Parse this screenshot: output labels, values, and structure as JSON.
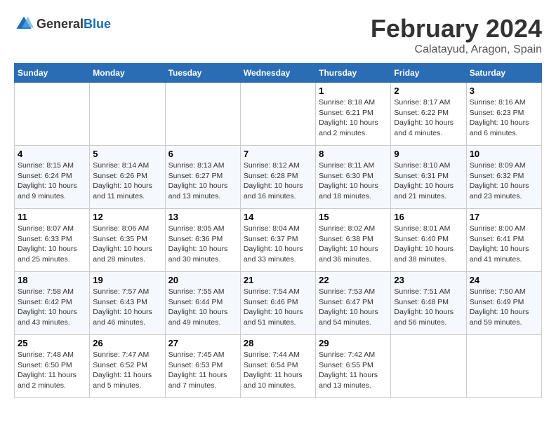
{
  "header": {
    "logo_general": "General",
    "logo_blue": "Blue",
    "month_year": "February 2024",
    "location": "Calatayud, Aragon, Spain"
  },
  "weekdays": [
    "Sunday",
    "Monday",
    "Tuesday",
    "Wednesday",
    "Thursday",
    "Friday",
    "Saturday"
  ],
  "weeks": [
    [
      {
        "day": "",
        "sunrise": "",
        "sunset": "",
        "daylight": ""
      },
      {
        "day": "",
        "sunrise": "",
        "sunset": "",
        "daylight": ""
      },
      {
        "day": "",
        "sunrise": "",
        "sunset": "",
        "daylight": ""
      },
      {
        "day": "",
        "sunrise": "",
        "sunset": "",
        "daylight": ""
      },
      {
        "day": "1",
        "sunrise": "Sunrise: 8:18 AM",
        "sunset": "Sunset: 6:21 PM",
        "daylight": "Daylight: 10 hours and 2 minutes."
      },
      {
        "day": "2",
        "sunrise": "Sunrise: 8:17 AM",
        "sunset": "Sunset: 6:22 PM",
        "daylight": "Daylight: 10 hours and 4 minutes."
      },
      {
        "day": "3",
        "sunrise": "Sunrise: 8:16 AM",
        "sunset": "Sunset: 6:23 PM",
        "daylight": "Daylight: 10 hours and 6 minutes."
      }
    ],
    [
      {
        "day": "4",
        "sunrise": "Sunrise: 8:15 AM",
        "sunset": "Sunset: 6:24 PM",
        "daylight": "Daylight: 10 hours and 9 minutes."
      },
      {
        "day": "5",
        "sunrise": "Sunrise: 8:14 AM",
        "sunset": "Sunset: 6:26 PM",
        "daylight": "Daylight: 10 hours and 11 minutes."
      },
      {
        "day": "6",
        "sunrise": "Sunrise: 8:13 AM",
        "sunset": "Sunset: 6:27 PM",
        "daylight": "Daylight: 10 hours and 13 minutes."
      },
      {
        "day": "7",
        "sunrise": "Sunrise: 8:12 AM",
        "sunset": "Sunset: 6:28 PM",
        "daylight": "Daylight: 10 hours and 16 minutes."
      },
      {
        "day": "8",
        "sunrise": "Sunrise: 8:11 AM",
        "sunset": "Sunset: 6:30 PM",
        "daylight": "Daylight: 10 hours and 18 minutes."
      },
      {
        "day": "9",
        "sunrise": "Sunrise: 8:10 AM",
        "sunset": "Sunset: 6:31 PM",
        "daylight": "Daylight: 10 hours and 21 minutes."
      },
      {
        "day": "10",
        "sunrise": "Sunrise: 8:09 AM",
        "sunset": "Sunset: 6:32 PM",
        "daylight": "Daylight: 10 hours and 23 minutes."
      }
    ],
    [
      {
        "day": "11",
        "sunrise": "Sunrise: 8:07 AM",
        "sunset": "Sunset: 6:33 PM",
        "daylight": "Daylight: 10 hours and 25 minutes."
      },
      {
        "day": "12",
        "sunrise": "Sunrise: 8:06 AM",
        "sunset": "Sunset: 6:35 PM",
        "daylight": "Daylight: 10 hours and 28 minutes."
      },
      {
        "day": "13",
        "sunrise": "Sunrise: 8:05 AM",
        "sunset": "Sunset: 6:36 PM",
        "daylight": "Daylight: 10 hours and 30 minutes."
      },
      {
        "day": "14",
        "sunrise": "Sunrise: 8:04 AM",
        "sunset": "Sunset: 6:37 PM",
        "daylight": "Daylight: 10 hours and 33 minutes."
      },
      {
        "day": "15",
        "sunrise": "Sunrise: 8:02 AM",
        "sunset": "Sunset: 6:38 PM",
        "daylight": "Daylight: 10 hours and 36 minutes."
      },
      {
        "day": "16",
        "sunrise": "Sunrise: 8:01 AM",
        "sunset": "Sunset: 6:40 PM",
        "daylight": "Daylight: 10 hours and 38 minutes."
      },
      {
        "day": "17",
        "sunrise": "Sunrise: 8:00 AM",
        "sunset": "Sunset: 6:41 PM",
        "daylight": "Daylight: 10 hours and 41 minutes."
      }
    ],
    [
      {
        "day": "18",
        "sunrise": "Sunrise: 7:58 AM",
        "sunset": "Sunset: 6:42 PM",
        "daylight": "Daylight: 10 hours and 43 minutes."
      },
      {
        "day": "19",
        "sunrise": "Sunrise: 7:57 AM",
        "sunset": "Sunset: 6:43 PM",
        "daylight": "Daylight: 10 hours and 46 minutes."
      },
      {
        "day": "20",
        "sunrise": "Sunrise: 7:55 AM",
        "sunset": "Sunset: 6:44 PM",
        "daylight": "Daylight: 10 hours and 49 minutes."
      },
      {
        "day": "21",
        "sunrise": "Sunrise: 7:54 AM",
        "sunset": "Sunset: 6:46 PM",
        "daylight": "Daylight: 10 hours and 51 minutes."
      },
      {
        "day": "22",
        "sunrise": "Sunrise: 7:53 AM",
        "sunset": "Sunset: 6:47 PM",
        "daylight": "Daylight: 10 hours and 54 minutes."
      },
      {
        "day": "23",
        "sunrise": "Sunrise: 7:51 AM",
        "sunset": "Sunset: 6:48 PM",
        "daylight": "Daylight: 10 hours and 56 minutes."
      },
      {
        "day": "24",
        "sunrise": "Sunrise: 7:50 AM",
        "sunset": "Sunset: 6:49 PM",
        "daylight": "Daylight: 10 hours and 59 minutes."
      }
    ],
    [
      {
        "day": "25",
        "sunrise": "Sunrise: 7:48 AM",
        "sunset": "Sunset: 6:50 PM",
        "daylight": "Daylight: 11 hours and 2 minutes."
      },
      {
        "day": "26",
        "sunrise": "Sunrise: 7:47 AM",
        "sunset": "Sunset: 6:52 PM",
        "daylight": "Daylight: 11 hours and 5 minutes."
      },
      {
        "day": "27",
        "sunrise": "Sunrise: 7:45 AM",
        "sunset": "Sunset: 6:53 PM",
        "daylight": "Daylight: 11 hours and 7 minutes."
      },
      {
        "day": "28",
        "sunrise": "Sunrise: 7:44 AM",
        "sunset": "Sunset: 6:54 PM",
        "daylight": "Daylight: 11 hours and 10 minutes."
      },
      {
        "day": "29",
        "sunrise": "Sunrise: 7:42 AM",
        "sunset": "Sunset: 6:55 PM",
        "daylight": "Daylight: 11 hours and 13 minutes."
      },
      {
        "day": "",
        "sunrise": "",
        "sunset": "",
        "daylight": ""
      },
      {
        "day": "",
        "sunrise": "",
        "sunset": "",
        "daylight": ""
      }
    ]
  ]
}
